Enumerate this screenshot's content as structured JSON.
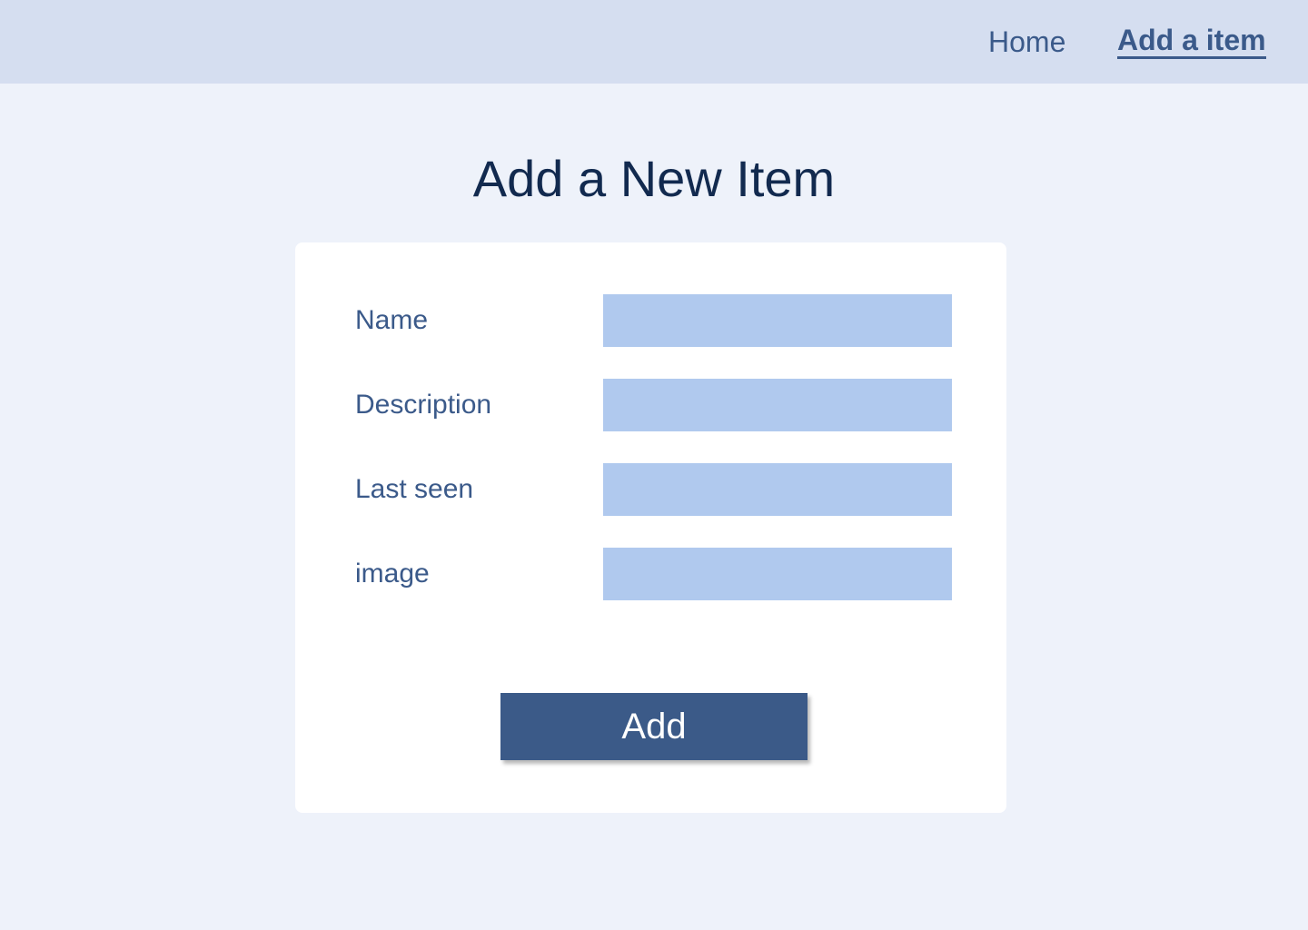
{
  "nav": {
    "home_label": "Home",
    "add_item_label": "Add a item"
  },
  "page": {
    "title": "Add a New Item"
  },
  "form": {
    "fields": [
      {
        "label": "Name",
        "value": "",
        "placeholder": ""
      },
      {
        "label": "Description",
        "value": "",
        "placeholder": ""
      },
      {
        "label": "Last seen",
        "value": "",
        "placeholder": ""
      },
      {
        "label": "image",
        "value": "",
        "placeholder": ""
      }
    ],
    "submit_label": "Add"
  },
  "colors": {
    "background": "#eef2fa",
    "topbar": "#d5def0",
    "nav_text": "#3b5a8a",
    "title_text": "#122a4f",
    "card": "#ffffff",
    "input_fill": "#b0c9ee",
    "button_fill": "#3b5a88",
    "button_text": "#ffffff"
  }
}
